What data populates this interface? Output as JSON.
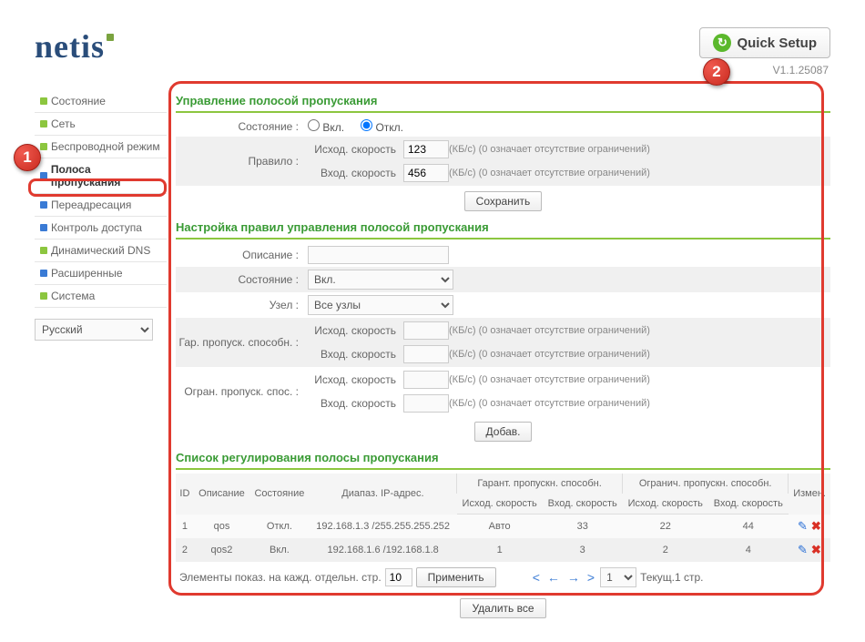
{
  "header": {
    "logo": "netis",
    "quick_setup": "Quick Setup",
    "version": "V1.1.25087"
  },
  "sidebar": {
    "items": [
      {
        "label": "Состояние"
      },
      {
        "label": "Сеть"
      },
      {
        "label": "Беспроводной режим"
      },
      {
        "label": "Полоса пропускания"
      },
      {
        "label": "Переадресация"
      },
      {
        "label": "Контроль доступа"
      },
      {
        "label": "Динамический DNS"
      },
      {
        "label": "Расширенные"
      },
      {
        "label": "Система"
      }
    ],
    "language": "Русский"
  },
  "bw_control": {
    "title": "Управление полосой пропускания",
    "state_label": "Состояние :",
    "state_on": "Вкл.",
    "state_off": "Откл.",
    "rule_label": "Правило :",
    "out_label": "Исход. скорость",
    "in_label": "Вход. скорость",
    "out_value": "123",
    "in_value": "456",
    "unit_hint": "(КБ/с) (0 означает отсутствие ограничений)",
    "save_btn": "Сохранить"
  },
  "rule_cfg": {
    "title": "Настройка правил управления полосой пропускания",
    "desc_label": "Описание :",
    "desc_value": "",
    "state_label": "Состояние :",
    "state_value": "Вкл.",
    "node_label": "Узел :",
    "node_value": "Все узлы",
    "guar_label": "Гар. пропуск. способн. :",
    "limit_label": "Огран. пропуск. спос. :",
    "out_label": "Исход. скорость",
    "in_label": "Вход. скорость",
    "unit_hint": "(КБ/с) (0 означает отсутствие ограничений)",
    "add_btn": "Добав."
  },
  "list": {
    "title": "Список регулирования полосы пропускания",
    "cols": {
      "id": "ID",
      "desc": "Описание",
      "state": "Состояние",
      "ip": "Диапаз. IP-адрес.",
      "guar": "Гарант. пропускн. способн.",
      "limit": "Огранич. пропускн. способн.",
      "out": "Исход. скорость",
      "in": "Вход. скорость",
      "mod": "Измен."
    },
    "rows": [
      {
        "id": "1",
        "desc": "qos",
        "state": "Откл.",
        "ip": "192.168.1.3 /255.255.255.252",
        "g_out": "Авто",
        "g_in": "33",
        "l_out": "22",
        "l_in": "44"
      },
      {
        "id": "2",
        "desc": "qos2",
        "state": "Вкл.",
        "ip": "192.168.1.6 /192.168.1.8",
        "g_out": "1",
        "g_in": "3",
        "l_out": "2",
        "l_in": "4"
      }
    ],
    "pager": {
      "per_page_label": "Элементы показ. на кажд. отдельн. стр.",
      "per_page": "10",
      "apply": "Применить",
      "page_sel": "1",
      "current": "Текущ.1 стр."
    },
    "delete_all": "Удалить все"
  }
}
